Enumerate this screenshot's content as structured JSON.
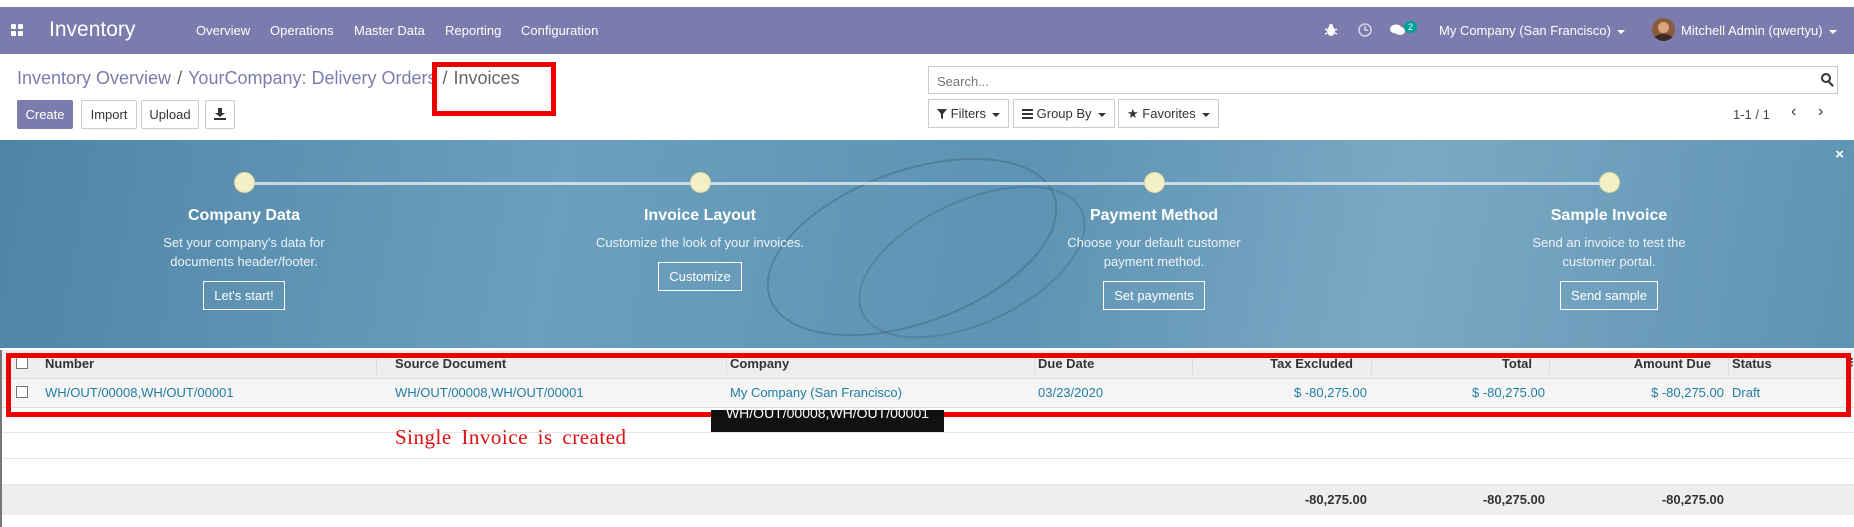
{
  "navbar": {
    "brand": "Inventory",
    "menu": [
      "Overview",
      "Operations",
      "Master Data",
      "Reporting",
      "Configuration"
    ],
    "messages_count": "2",
    "company": "My Company (San Francisco)",
    "user": "Mitchell Admin (qwertyu)",
    "bg_color": "#7c7bad"
  },
  "breadcrumb": {
    "items": [
      "Inventory Overview",
      "YourCompany: Delivery Orders",
      "Invoices"
    ]
  },
  "buttons": {
    "create": "Create",
    "import": "Import",
    "upload": "Upload",
    "download_icon": "download-icon"
  },
  "search": {
    "placeholder": "Search..."
  },
  "filters": {
    "filters": "Filters",
    "group_by": "Group By",
    "favorites": "Favorites"
  },
  "pager": {
    "value": "1-1 / 1"
  },
  "onboarding": {
    "steps": [
      {
        "title": "Company Data",
        "desc1": "Set your company's data for",
        "desc2": "documents header/footer.",
        "button": "Let's start!"
      },
      {
        "title": "Invoice Layout",
        "desc1": "Customize the look of your invoices.",
        "desc2": "",
        "button": "Customize"
      },
      {
        "title": "Payment Method",
        "desc1": "Choose your default customer",
        "desc2": "payment method.",
        "button": "Set payments"
      },
      {
        "title": "Sample Invoice",
        "desc1": "Send an invoice to test the",
        "desc2": "customer portal.",
        "button": "Send sample"
      }
    ],
    "close": "×"
  },
  "table": {
    "columns": [
      "Number",
      "Source Document",
      "Company",
      "Due Date",
      "Tax Excluded",
      "Total",
      "Amount Due",
      "Status"
    ],
    "rows": [
      {
        "number": "WH/OUT/00008,WH/OUT/00001",
        "source": "WH/OUT/00008,WH/OUT/00001",
        "company": "My Company (San Francisco)",
        "due_date": "03/23/2020",
        "tax_excluded": "$ -80,275.00",
        "total": "$ -80,275.00",
        "amount_due": "$ -80,275.00",
        "status": "Draft"
      }
    ],
    "totals": {
      "tax_excluded": "-80,275.00",
      "total": "-80,275.00",
      "amount_due": "-80,275.00"
    }
  },
  "tooltip": "WH/OUT/00008,WH/OUT/00001",
  "annotation": "Single Invoice is created",
  "highlight_color": "#ee0000"
}
